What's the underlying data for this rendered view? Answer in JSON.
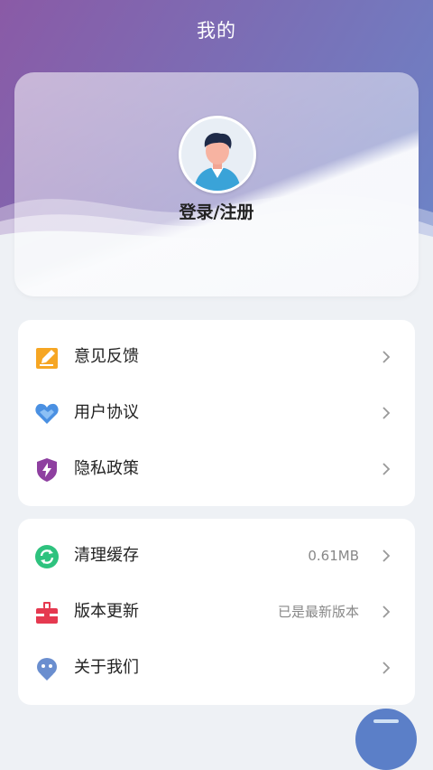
{
  "header": {
    "title": "我的"
  },
  "profile": {
    "login_label": "登录/注册",
    "avatar_icon": "user-avatar-icon"
  },
  "group1": {
    "items": [
      {
        "label": "意见反馈",
        "icon": "feedback-edit-icon",
        "color": "#f6a623"
      },
      {
        "label": "用户协议",
        "icon": "heart-handshake-icon",
        "color": "#4a90e2"
      },
      {
        "label": "隐私政策",
        "icon": "shield-bolt-icon",
        "color": "#8e3fa0"
      }
    ]
  },
  "group2": {
    "items": [
      {
        "label": "清理缓存",
        "value": "0.61MB",
        "icon": "refresh-icon",
        "color": "#2ec27e"
      },
      {
        "label": "版本更新",
        "value": "已是最新版本",
        "icon": "toolbox-icon",
        "color": "#e53950"
      },
      {
        "label": "关于我们",
        "icon": "mascot-icon",
        "color": "#6a8ecf"
      }
    ]
  },
  "colors": {
    "hero_start": "#8a5aa6",
    "hero_end": "#6c84c7",
    "background": "#eef1f5"
  }
}
